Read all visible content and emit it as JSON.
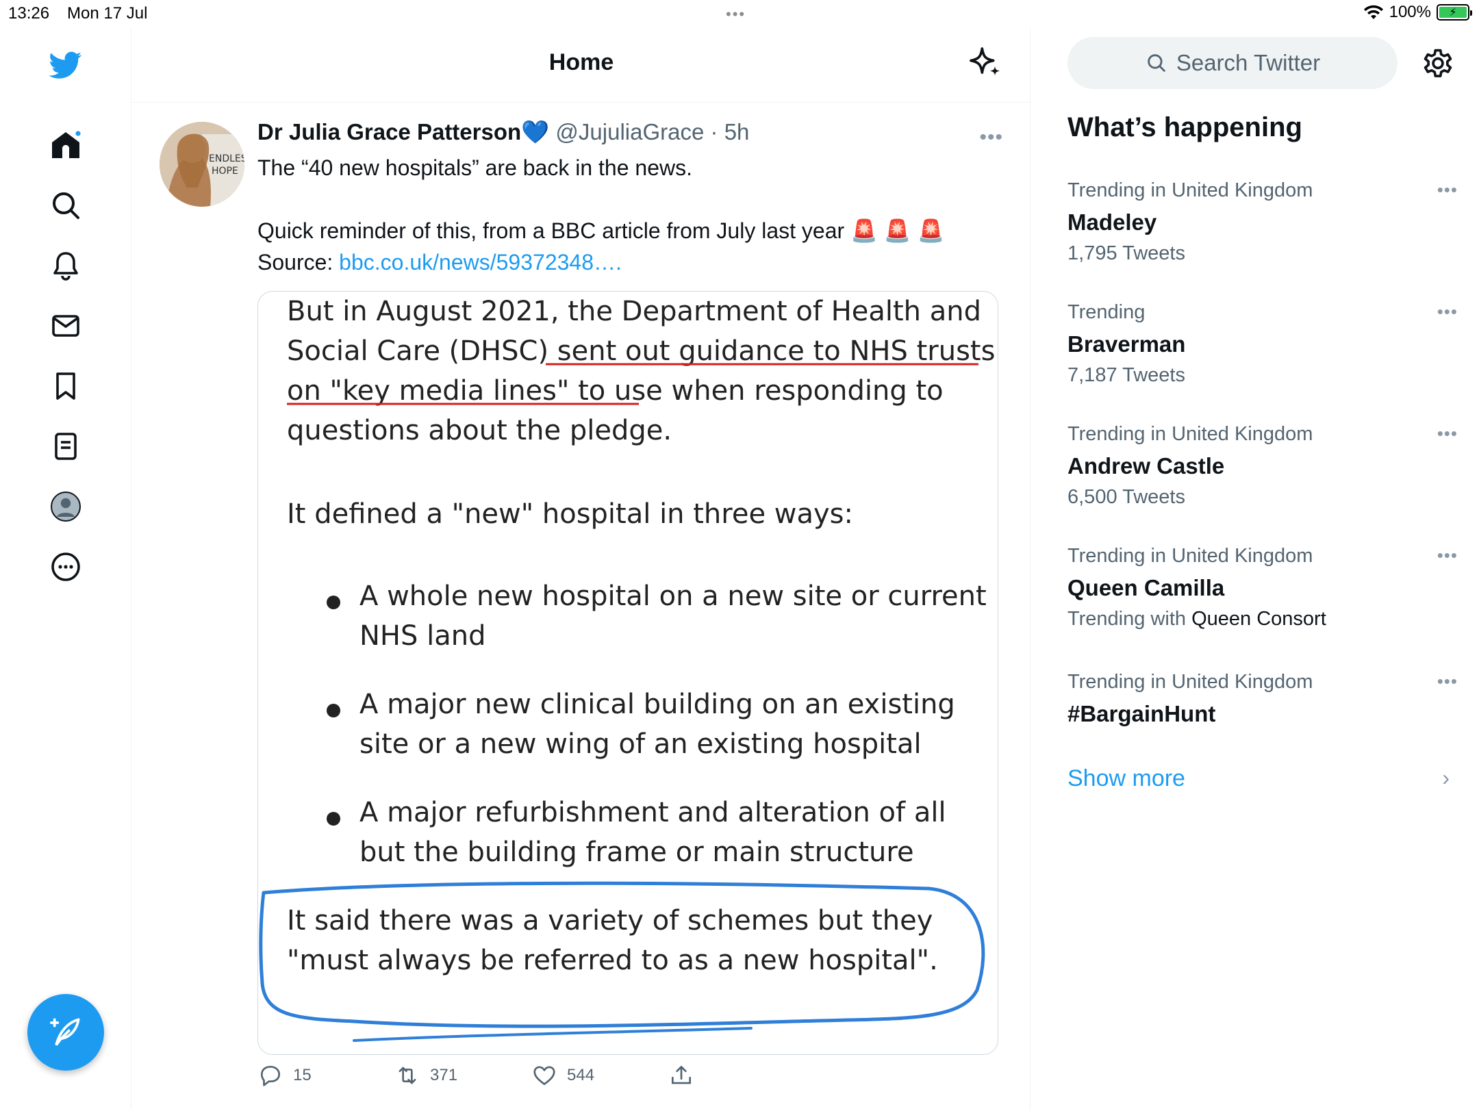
{
  "status": {
    "time": "13:26",
    "date": "Mon 17 Jul",
    "battery": "100%"
  },
  "header": {
    "title": "Home"
  },
  "tweet": {
    "name": "Dr Julia Grace Patterson",
    "verified_emoji": "💙",
    "handle": "@JujuliaGrace",
    "separator": "·",
    "time": "5h",
    "line1": "The “40 new hospitals” are back in the news.",
    "line2": "Quick reminder of this, from a BBC article from July last year",
    "emoji": "🚨 🚨 🚨",
    "source_label": "Source: ",
    "source_link": "bbc.co.uk/news/59372348….",
    "image_text": {
      "para1_line1": "But in August 2021, the Department of Health and",
      "para1_line2": "Social Care (DHSC) sent out guidance to NHS trusts",
      "para1_line3": "on \"key media lines\" to use when responding to",
      "para1_line4": "questions about the pledge.",
      "para2": "It defined a \"new\" hospital in three ways:",
      "bullet1_line1": "A whole new hospital on a new site or current",
      "bullet1_line2": "NHS land",
      "bullet2_line1": "A major new clinical building on an existing",
      "bullet2_line2": "site or a new wing of an existing hospital",
      "bullet3_line1": "A major refurbishment and alteration of all",
      "bullet3_line2": "but the building frame or main structure",
      "para3_line1": "It said there was a variety of schemes but they",
      "para3_line2": "\"must always be referred to as a new hospital\"."
    },
    "actions": {
      "replies": "15",
      "retweets": "371",
      "likes": "544"
    }
  },
  "search": {
    "placeholder": "Search Twitter"
  },
  "trends": {
    "title": "What’s happening",
    "items": [
      {
        "context": "Trending in United Kingdom",
        "title": "Madeley",
        "count": "1,795 Tweets"
      },
      {
        "context": "Trending",
        "title": "Braverman",
        "count": "7,187 Tweets"
      },
      {
        "context": "Trending in United Kingdom",
        "title": "Andrew Castle",
        "count": "6,500 Tweets"
      },
      {
        "context": "Trending in United Kingdom",
        "title": "Queen Camilla",
        "count_prefix": "Trending with ",
        "count_highlight": "Queen Consort"
      },
      {
        "context": "Trending in United Kingdom",
        "title": "#BargainHunt"
      }
    ],
    "show_more": "Show more"
  },
  "colors": {
    "accent": "#1d9bf0",
    "text": "#0f1419",
    "secondary": "#536471",
    "underline_red": "#d61f1f",
    "circle_blue": "#2f7fd8"
  }
}
